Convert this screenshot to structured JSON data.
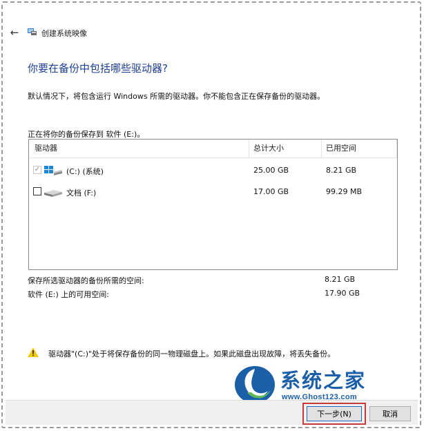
{
  "window": {
    "title": "创建系统映像"
  },
  "heading": "你要在备份中包括哪些驱动器?",
  "description": "默认情况下，将包含运行 Windows 所需的驱动器。你不能包含正在保存备份的驱动器。",
  "save_to": "正在将你的备份保存到 软件 (E:)。",
  "table": {
    "columns": [
      "驱动器",
      "总计大小",
      "已用空间"
    ],
    "rows": [
      {
        "name": "(C:) (系统)",
        "total": "25.00 GB",
        "used": "8.21 GB",
        "checked": true,
        "disabled": true,
        "icon": "windows-drive-icon"
      },
      {
        "name": "文档 (F:)",
        "total": "17.00 GB",
        "used": "99.29 MB",
        "checked": false,
        "disabled": false,
        "icon": "drive-icon"
      }
    ]
  },
  "summary": {
    "required_label": "保存所选驱动器的备份所需的空间:",
    "required_value": "8.21 GB",
    "available_label": "软件 (E:) 上的可用空间:",
    "available_value": "17.90 GB"
  },
  "warning": "驱动器\"(C:)\"处于将保存备份的同一物理磁盘上。如果此磁盘出现故障，将丢失备份。",
  "watermark": {
    "title": "系统之家",
    "url": "www.Ghost123.com"
  },
  "buttons": {
    "next": "下一步(N)",
    "cancel": "取消"
  },
  "colors": {
    "heading": "#1d3f8f",
    "accent": "#1d66c4",
    "highlight_outline": "#c73a3a",
    "watermark": "#1b5fa8"
  }
}
